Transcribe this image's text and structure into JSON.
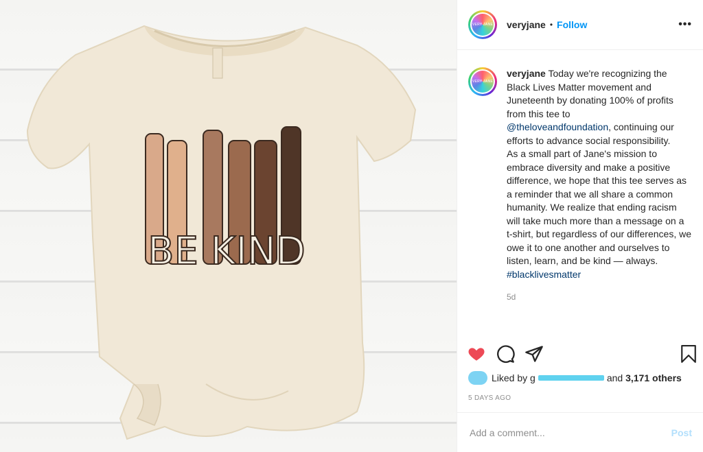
{
  "post": {
    "username": "veryjane",
    "dot": "•",
    "follow_label": "Follow",
    "more_label": "•••",
    "avatar_text": "VERY JANE",
    "caption_lines": [
      "Today we're recognizing the",
      "Black Lives Matter movement and",
      "Juneteenth by donating 100% of",
      "profits from this tee to"
    ],
    "mention": "@theloveandfoundation",
    "caption_after_mention": [
      ", continuing",
      "our efforts to advance social",
      "responsibility."
    ],
    "caption_paragraph2": [
      "As a small part of Jane's mission to",
      "embrace diversity and make a positive",
      "difference, we hope that this tee",
      "serves as a reminder that we all share",
      "a common humanity. We realize that",
      "ending racism will take much more",
      "than a message on a t-shirt, but",
      "regardless of our differences, we owe",
      "it to one another and ourselves to",
      "listen, learn, and be kind — always."
    ],
    "hashtag": "#blacklivesmatter",
    "caption_time": "5d",
    "liked_by_prefix": "Liked by",
    "liked_by_user": "g",
    "liked_and": "and",
    "likes_count": "3,171 others",
    "days_ago": "5 DAYS AGO",
    "comment_placeholder": "Add a comment...",
    "post_label": "Post",
    "shirt_text": "BE KIND"
  },
  "colors": {
    "accent": "#0095f6",
    "heart": "#ed4956",
    "post_disabled": "#b2dffc",
    "mention": "#00376b",
    "shirt": "#f1e8d7"
  },
  "icons": [
    "heart-icon",
    "comment-icon",
    "share-icon",
    "bookmark-icon",
    "more-icon"
  ]
}
